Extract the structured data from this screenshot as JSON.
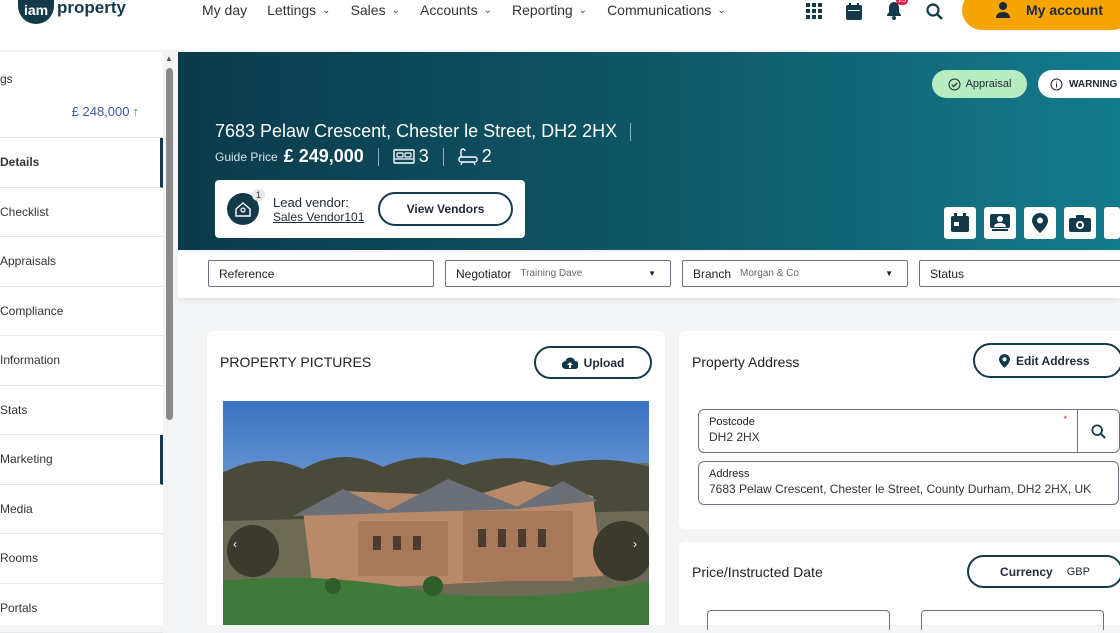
{
  "brand": {
    "circle_text": "iam",
    "name": "property"
  },
  "nav": [
    {
      "label": "My day",
      "dropdown": false
    },
    {
      "label": "Lettings",
      "dropdown": true
    },
    {
      "label": "Sales",
      "dropdown": true
    },
    {
      "label": "Accounts",
      "dropdown": true
    },
    {
      "label": "Reporting",
      "dropdown": true
    },
    {
      "label": "Communications",
      "dropdown": true
    }
  ],
  "notifications_count": "25",
  "account_label": "My account",
  "sidebar": {
    "heading": "gs",
    "price": "£ 248,000",
    "items": [
      "Details",
      "Checklist",
      "Appraisals",
      "Compliance",
      "Information",
      "Stats",
      "Marketing",
      "Media",
      "Rooms",
      "Portals"
    ]
  },
  "property": {
    "address": "7683 Pelaw Crescent, Chester le Street, DH2 2HX",
    "guide_label": "Guide Price",
    "guide_price": "£ 249,000",
    "bedrooms": "3",
    "bathrooms": "2",
    "vendor_count": "1",
    "lead_vendor_label": "Lead vendor:",
    "lead_vendor_name": "Sales Vendor101",
    "view_vendors": "View Vendors",
    "status_pills": {
      "appraisal": "Appraisal",
      "warning": "WARNING"
    }
  },
  "filters": {
    "reference": "Reference",
    "negotiator_label": "Negotiator",
    "negotiator_value": "Training Dave",
    "branch_label": "Branch",
    "branch_value": "Morgan & Co",
    "status": "Status"
  },
  "pictures": {
    "title": "PROPERTY PICTURES",
    "upload": "Upload"
  },
  "address_card": {
    "title": "Property Address",
    "edit": "Edit Address",
    "postcode_label": "Postcode",
    "postcode_value": "DH2 2HX",
    "address_label": "Address",
    "address_value": "7683 Pelaw Crescent, Chester le Street, County Durham, DH2 2HX, UK"
  },
  "price_card": {
    "title": "Price/Instructed Date",
    "currency_label": "Currency",
    "currency_value": "GBP"
  },
  "colors": {
    "brand_dark": "#123a4a",
    "accent": "#f5a500",
    "appraisal": "#b7ecc0"
  }
}
